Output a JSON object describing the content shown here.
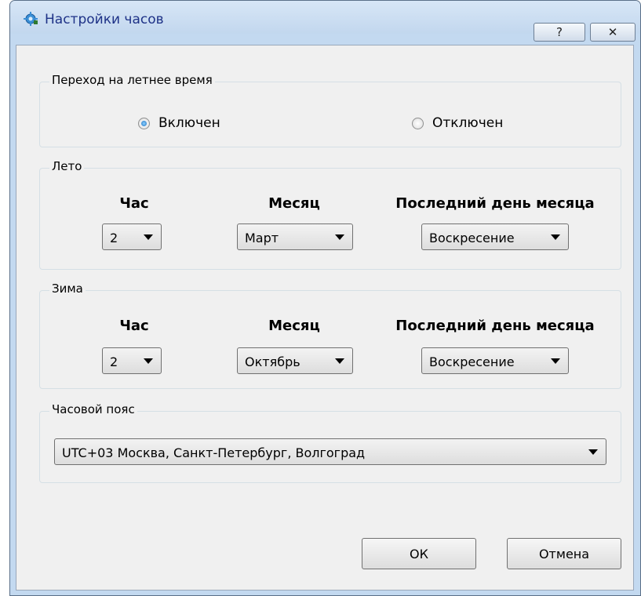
{
  "window": {
    "title": "Настройки часов",
    "help_label": "?",
    "close_label": "✕"
  },
  "dst": {
    "title": "Переход на летнее время",
    "options": [
      {
        "label": "Включен",
        "selected": true
      },
      {
        "label": "Отключен",
        "selected": false
      }
    ]
  },
  "summer": {
    "title": "Лето",
    "hour_header": "Час",
    "month_header": "Месяц",
    "day_header": "Последний день месяца",
    "hour_value": "2",
    "month_value": "Март",
    "day_value": "Воскресение"
  },
  "winter": {
    "title": "Зима",
    "hour_header": "Час",
    "month_header": "Месяц",
    "day_header": "Последний день месяца",
    "hour_value": "2",
    "month_value": "Октябрь",
    "day_value": "Воскресение"
  },
  "timezone": {
    "title": "Часовой пояс",
    "value": "UTC+03 Москва, Санкт-Петербург, Волгоград"
  },
  "buttons": {
    "ok": "ОК",
    "cancel": "Отмена"
  }
}
